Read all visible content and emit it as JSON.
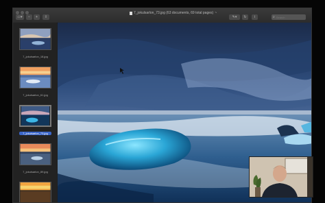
{
  "window": {
    "title": "7_jokulsarlon_73.jpg (63 documents, 69 total pages)",
    "title_chevron": "~",
    "search_placeholder": "Search"
  },
  "toolbar": {
    "sidebar_toggle_icon": "sidebar-icon",
    "zoom_out_icon": "magnifier-minus-icon",
    "zoom_in_icon": "magnifier-plus-icon",
    "share_icon": "share-icon",
    "markup_icon": "pen-icon",
    "rotate_icon": "rotate-icon",
    "info_icon": "info-icon"
  },
  "thumbnails": [
    {
      "label": "7_jokulsarlon_18.jpg",
      "selected": false
    },
    {
      "label": "7_jokulsarlon_61.jpg",
      "selected": false
    },
    {
      "label": "7_jokulsarlon_73.jpg",
      "selected": true
    },
    {
      "label": "7_jokulsarlon_89.jpg",
      "selected": false
    },
    {
      "label": "",
      "selected": false
    }
  ],
  "colors": {
    "selection": "#3b66c9",
    "sky": "#3a5f93",
    "ice": "#2aa6d6"
  }
}
